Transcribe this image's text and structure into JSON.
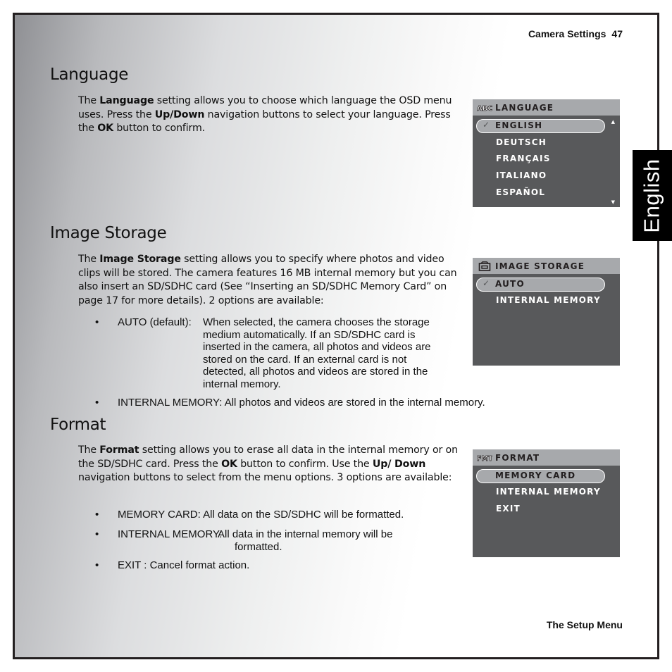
{
  "header": {
    "section": "Camera Settings",
    "page_number": "47"
  },
  "footer": {
    "chapter": "The Setup Menu"
  },
  "side_tab": {
    "label": "English"
  },
  "language": {
    "heading": "Language",
    "paragraph": [
      {
        "t": "The ",
        "b": false
      },
      {
        "t": "Language",
        "b": true
      },
      {
        "t": " setting allows you to choose which language the OSD menu uses. Press the ",
        "b": false
      },
      {
        "t": "Up/Down",
        "b": true
      },
      {
        "t": " navigation buttons to select your language. Press the ",
        "b": false
      },
      {
        "t": "OK",
        "b": true
      },
      {
        "t": " button to confirm.",
        "b": false
      }
    ],
    "screen": {
      "icon": "abc-icon",
      "icon_text": "ABC",
      "title": "LANGUAGE",
      "selected": "ENGLISH",
      "check": "✓",
      "items": [
        "DEUTSCH",
        "FRANÇAIS",
        "ITALIANO",
        "ESPAÑOL"
      ],
      "scroll_up": "▲",
      "scroll_down": "▼"
    }
  },
  "image_storage": {
    "heading": "Image Storage",
    "paragraph": [
      {
        "t": "The ",
        "b": false
      },
      {
        "t": "Image Storage",
        "b": true
      },
      {
        "t": " setting allows you to specify where photos and video clips will be stored. The camera features 16 MB internal memory but you can also insert an SD/SDHC card (See “Inserting an SD/SDHC Memory Card” on page 17 for more details). 2 options are available:",
        "b": false
      }
    ],
    "bullets": [
      {
        "label": "AUTO (default):",
        "lines": [
          "When selected, the camera chooses the storage",
          "medium automatically. If an SD/SDHC card is",
          "inserted in the camera, all photos and videos are",
          "stored on the card. If an external card is not",
          "detected, all photos and videos are stored in the",
          "internal memory."
        ]
      },
      {
        "label": "INTERNAL MEMORY:",
        "lines": [
          "All photos and videos are stored in the internal memory."
        ]
      }
    ],
    "screen": {
      "icon": "memory-card-icon",
      "title": "IMAGE STORAGE",
      "selected": "AUTO",
      "check": "✓",
      "items": [
        "INTERNAL MEMORY"
      ]
    }
  },
  "format": {
    "heading": "Format",
    "paragraph": [
      {
        "t": "The ",
        "b": false
      },
      {
        "t": "Format",
        "b": true
      },
      {
        "t": " setting allows you to erase all data in the internal memory or on the SD/SDHC card. Press the ",
        "b": false
      },
      {
        "t": "OK",
        "b": true
      },
      {
        "t": " button to confirm. Use the ",
        "b": false
      },
      {
        "t": "Up/ Down",
        "b": true
      },
      {
        "t": " navigation buttons to select from the menu options. 3 options are available:",
        "b": false
      }
    ],
    "bullets": [
      {
        "label": "MEMORY CARD:",
        "lines": [
          "All data on the SD/SDHC will be formatted."
        ]
      },
      {
        "label": "INTERNAL MEMORY:",
        "lines": [
          "All data in the internal memory will be",
          "formatted."
        ]
      },
      {
        "label": "EXIT :",
        "lines": [
          "Cancel format action."
        ]
      }
    ],
    "screen": {
      "icon": "format-icon",
      "icon_text": "FMT",
      "title": "FORMAT",
      "selected": "MEMORY CARD",
      "items": [
        "INTERNAL MEMORY",
        "EXIT"
      ]
    }
  }
}
